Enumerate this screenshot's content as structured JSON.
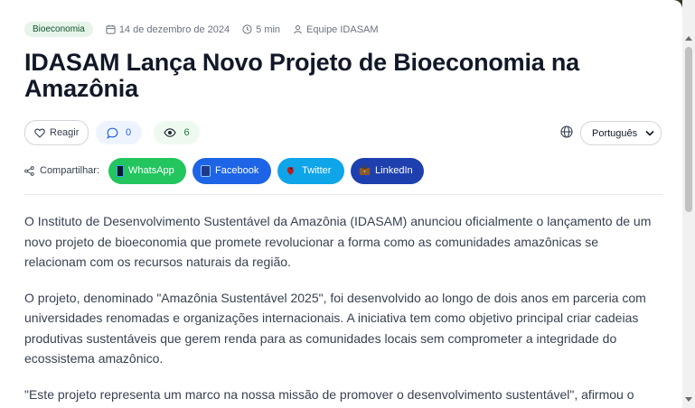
{
  "article": {
    "category": "Bioeconomia",
    "date": "14 de dezembro de 2024",
    "read_time": "5 min",
    "author": "Equipe IDASAM",
    "title": "IDASAM Lança Novo Projeto de Bioeconomia na Amazônia",
    "paragraphs": [
      "O Instituto de Desenvolvimento Sustentável da Amazônia (IDASAM) anunciou oficialmente o lançamento de um novo projeto de bioeconomia que promete revolucionar a forma como as comunidades amazônicas se relacionam com os recursos naturais da região.",
      "O projeto, denominado \"Amazônia Sustentável 2025\", foi desenvolvido ao longo de dois anos em parceria com universidades renomadas e organizações internacionais. A iniciativa tem como objetivo principal criar cadeias produtivas sustentáveis que gerem renda para as comunidades locais sem comprometer a integridade do ecossistema amazônico.",
      "\"Este projeto representa um marco na nossa missão de promover o desenvolvimento sustentável\", afirmou o"
    ]
  },
  "actions": {
    "react_label": "Reagir",
    "comments_count": "0",
    "views_count": "6",
    "language": "Português"
  },
  "share": {
    "label": "Compartilhar:",
    "buttons": [
      "WhatsApp",
      "Facebook",
      "Twitter",
      "LinkedIn"
    ]
  },
  "icons": {
    "meta": [
      "calendar-icon",
      "clock-icon",
      "user-icon"
    ],
    "actions": [
      "heart-icon",
      "comment-icon",
      "eye-icon",
      "globe-icon",
      "chevron-down-icon"
    ],
    "share": [
      "share-icon",
      "phone-icon",
      "tablet-icon",
      "bird-icon",
      "briefcase-icon"
    ]
  },
  "colors": {
    "whatsapp": "#22c55e",
    "facebook": "#1d64e6",
    "twitter": "#0ea5e9",
    "linkedin": "#1e40af",
    "category_badge_bg": "#e6f4ea"
  }
}
